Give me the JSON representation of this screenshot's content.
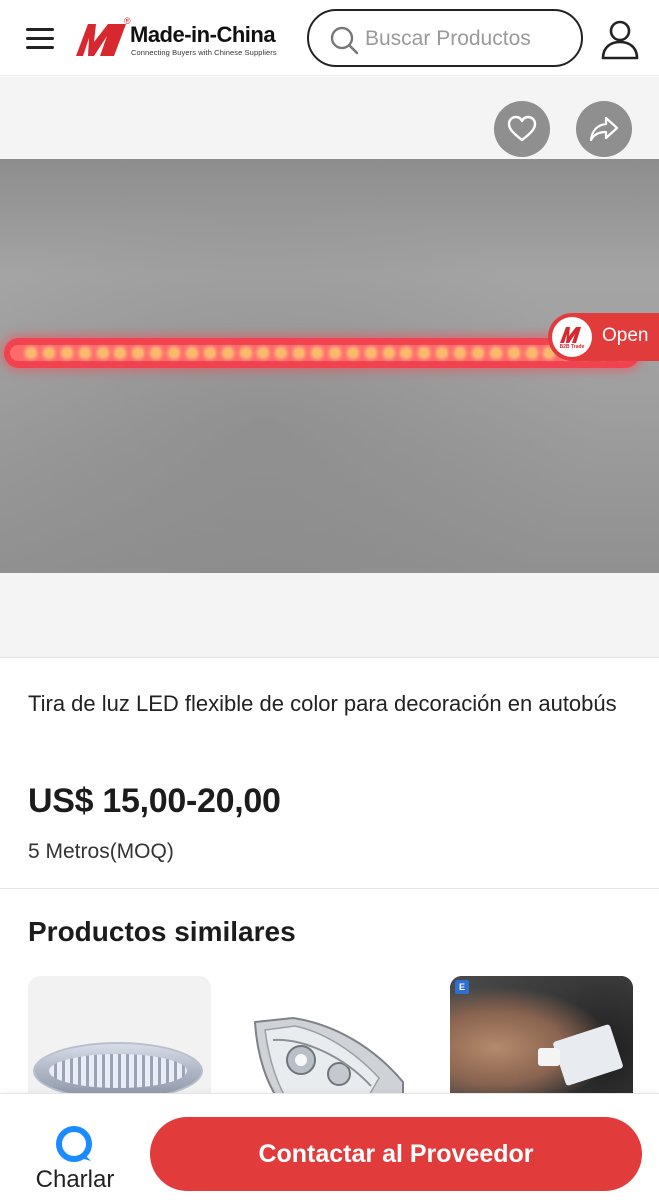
{
  "header": {
    "logo_text": "Made-in-China",
    "logo_tagline": "Connecting Buyers with Chinese Suppliers",
    "logo_registered": "®",
    "search_placeholder": "Buscar Productos"
  },
  "gallery": {
    "open_badge_label": "Open",
    "open_badge_logo_text": "B2B Trade"
  },
  "product": {
    "title": "Tira de luz LED flexible de color para decoración en autobús",
    "price": "US$ 15,00-20,00",
    "moq": "5 Metros(MOQ)"
  },
  "similar": {
    "heading": "Productos similares",
    "card_3_badge": "E"
  },
  "bottom_bar": {
    "chat_label": "Charlar",
    "contact_label": "Contactar al Proveedor"
  },
  "colors": {
    "brand_red": "#e23b3b",
    "chat_blue": "#1a8cff"
  }
}
